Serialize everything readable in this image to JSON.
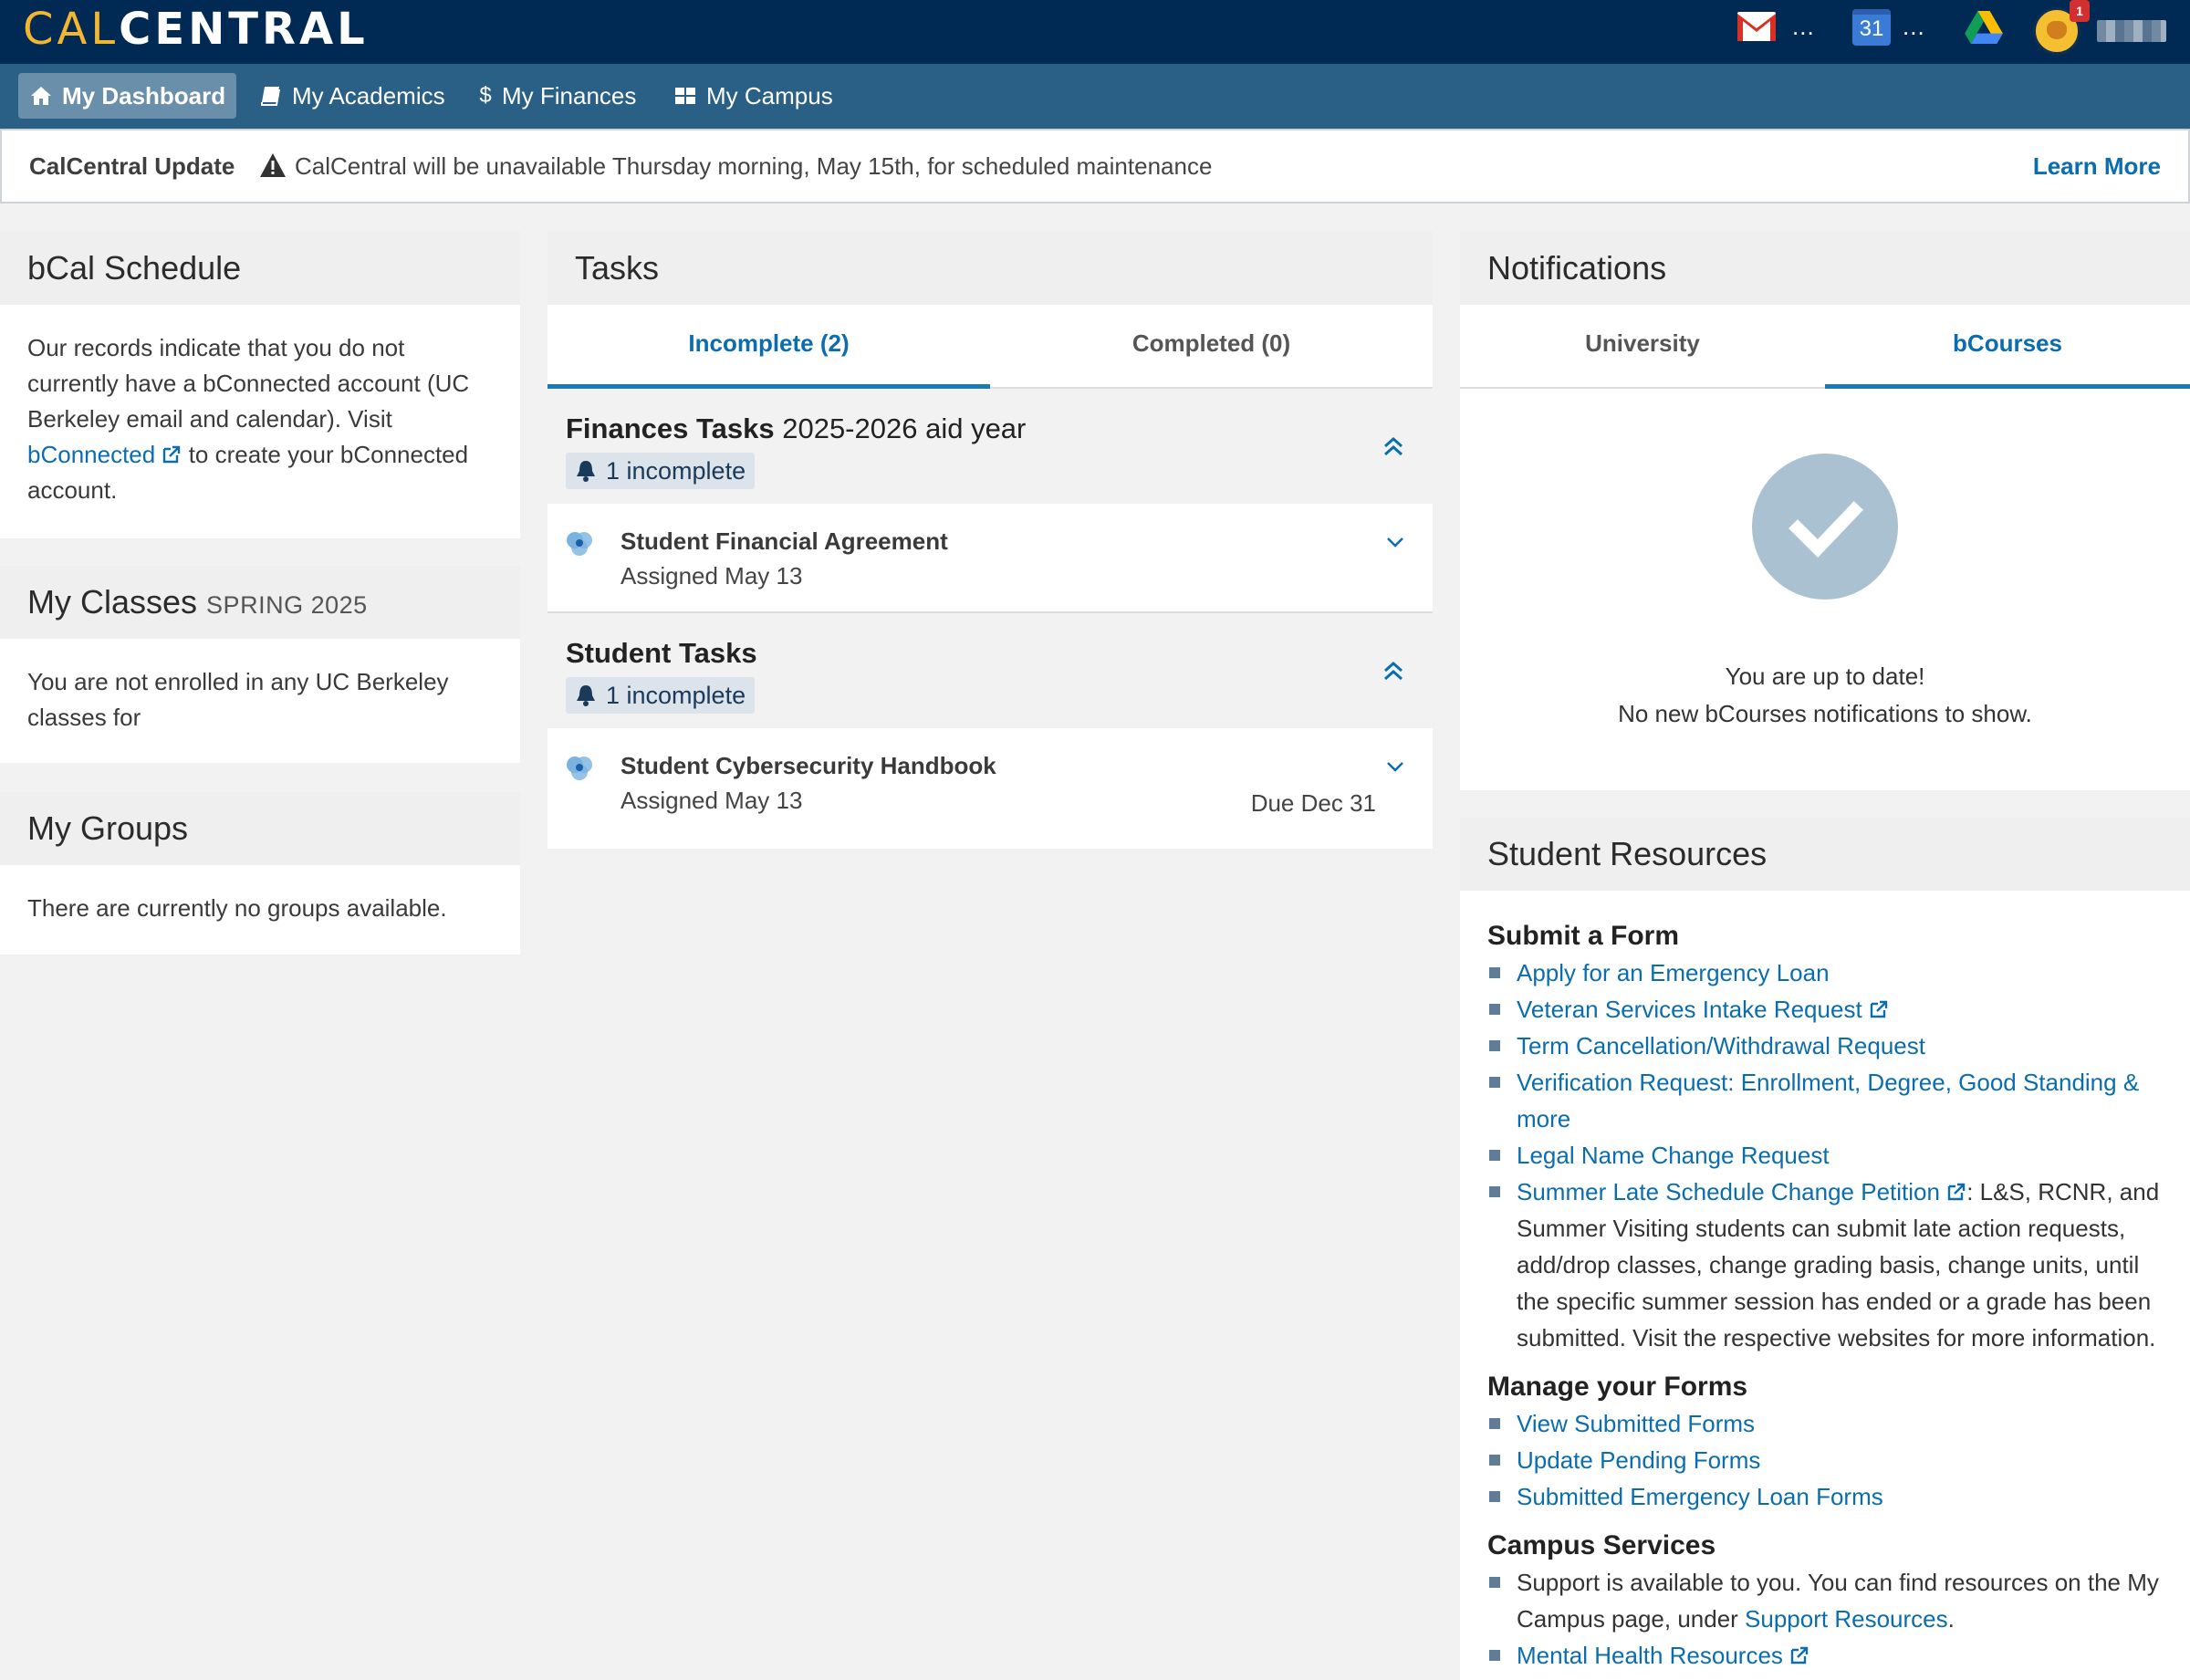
{
  "header": {
    "logo_cal": "CAL",
    "logo_central": "CENTRAL",
    "gmail_more": "...",
    "calendar_day": "31",
    "calendar_more": "...",
    "notification_count": "1"
  },
  "nav": {
    "items": [
      {
        "label": "My Dashboard",
        "icon": "home-icon",
        "active": true
      },
      {
        "label": "My Academics",
        "icon": "book-icon",
        "active": false
      },
      {
        "label": "My Finances",
        "icon": "dollar-icon",
        "active": false
      },
      {
        "label": "My Campus",
        "icon": "grid-icon",
        "active": false
      }
    ]
  },
  "alert": {
    "title": "CalCentral Update",
    "message": "CalCentral will be unavailable Thursday morning, May 15th, for scheduled maintenance",
    "link": "Learn More"
  },
  "bcal": {
    "title": "bCal Schedule",
    "text_before": "Our records indicate that you do not currently have a bConnected account (UC Berkeley email and calendar). Visit ",
    "link": "bConnected",
    "text_after": " to create your bConnected account."
  },
  "classes": {
    "title": "My Classes",
    "term": "SPRING 2025",
    "text": "You are not enrolled in any UC Berkeley classes for"
  },
  "groups": {
    "title": "My Groups",
    "text": "There are currently no groups available."
  },
  "tasks": {
    "title": "Tasks",
    "tab_incomplete": "Incomplete (2)",
    "tab_completed": "Completed (0)",
    "groups": [
      {
        "title_bold": "Finances Tasks",
        "title_rest": " 2025-2026 aid year",
        "incomplete": "1 incomplete",
        "item_title": "Student Financial Agreement",
        "item_sub": "Assigned May 13",
        "item_due": ""
      },
      {
        "title_bold": "Student Tasks",
        "title_rest": "",
        "incomplete": "1 incomplete",
        "item_title": "Student Cybersecurity Handbook",
        "item_sub": "Assigned May 13",
        "item_due": "Due Dec 31"
      }
    ]
  },
  "notifications": {
    "title": "Notifications",
    "tab_university": "University",
    "tab_bcourses": "bCourses",
    "line1": "You are up to date!",
    "line2": "No new bCourses notifications to show."
  },
  "resources": {
    "title": "Student Resources",
    "submit_heading": "Submit a Form",
    "submit": {
      "emergency_loan": "Apply for an Emergency Loan",
      "veteran": "Veteran Services Intake Request",
      "term_cancel": "Term Cancellation/Withdrawal Request",
      "verification": "Verification Request: Enrollment, Degree, Good Standing & more",
      "legal_name": "Legal Name Change Request",
      "summer_late": "Summer Late Schedule Change Petition",
      "summer_late_desc": ": L&S, RCNR, and Summer Visiting students can submit late action requests, add/drop classes, change grading basis, change units, until the specific summer session has ended or a grade has been submitted. Visit the respective websites for more information."
    },
    "manage_heading": "Manage your Forms",
    "manage": {
      "view": "View Submitted Forms",
      "update": "Update Pending Forms",
      "loan_forms": "Submitted Emergency Loan Forms"
    },
    "campus_heading": "Campus Services",
    "campus": {
      "support_text": "Support is available to you. You can find resources on the My Campus page, under ",
      "support_link": "Support Resources",
      "support_end": ".",
      "mental": "Mental Health Resources"
    }
  }
}
